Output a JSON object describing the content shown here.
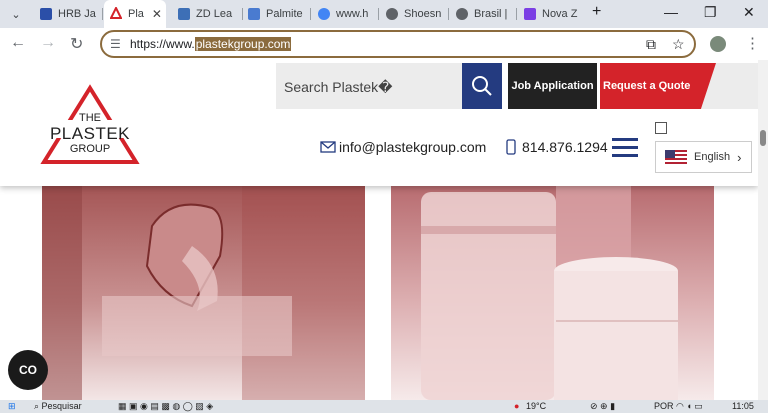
{
  "browser": {
    "tabs": [
      {
        "label": "HRB Ja",
        "color": "#2b4fa8"
      },
      {
        "label": "Pla",
        "color": "#d4232a",
        "active": true
      },
      {
        "label": "ZD Lea",
        "color": "#3d6fb6"
      },
      {
        "label": "Palmite",
        "color": "#4a7bd0"
      },
      {
        "label": "www.h",
        "color": "#4285f4"
      },
      {
        "label": "Shoesn",
        "color": "#5f6368"
      },
      {
        "label": "Brasil |",
        "color": "#5f6368"
      },
      {
        "label": "Nova Z",
        "color": "#7b3fe4"
      }
    ],
    "close_glyph": "✕",
    "new_tab_glyph": "+",
    "url_prefix": "https://www.",
    "url_selected": "plastekgroup.com"
  },
  "site": {
    "logo": {
      "line1": "THE",
      "line2": "PLASTEK",
      "line3": "GROUP"
    },
    "search_placeholder": "Search Plastek�",
    "job_button": "Job Application",
    "quote_button": "Request a Quote",
    "email": "info@plastekgroup.com",
    "phone": "814.876.1294",
    "language": "English",
    "chevron": "›"
  },
  "cc_button": "CO",
  "taskbar": {
    "search": "Pesquisar",
    "temp": "19°C",
    "lang": "POR",
    "time": "11:05"
  },
  "colors": {
    "brand_red": "#d4232a",
    "brand_blue": "#243b80",
    "omnibox_border": "#8b6b3d"
  }
}
